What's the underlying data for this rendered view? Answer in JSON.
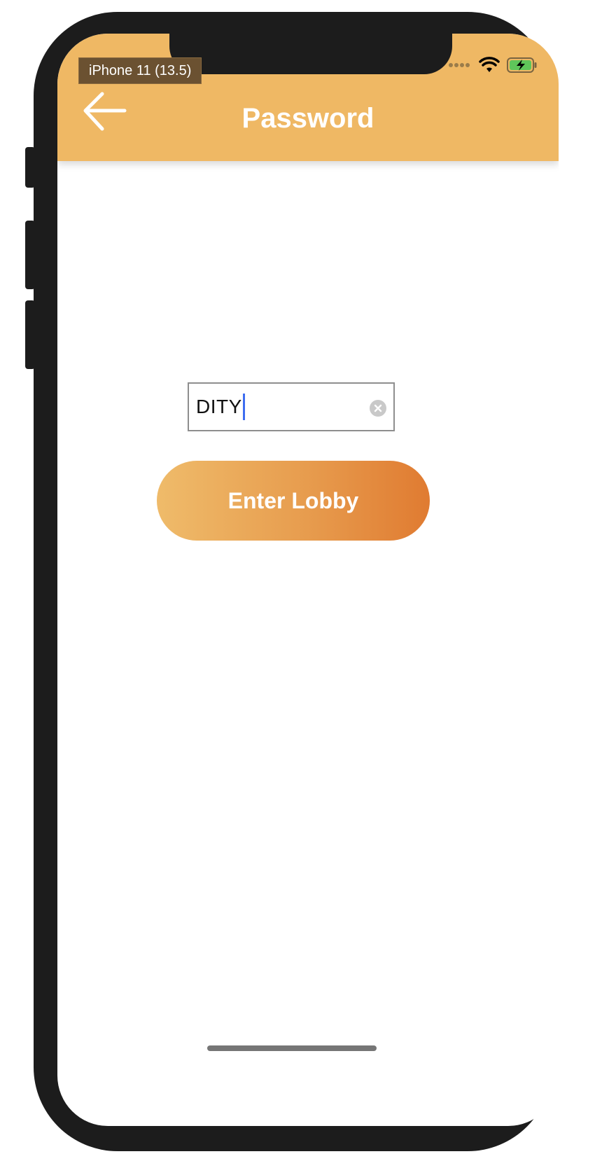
{
  "simulator": {
    "device_label": "iPhone 11 (13.5)"
  },
  "header": {
    "title": "Password",
    "background_color": "#efb864",
    "back_icon": "arrow-left-icon"
  },
  "status_bar": {
    "signal_icon": "signal-dots-icon",
    "wifi_icon": "wifi-icon",
    "battery_icon": "battery-charging-icon"
  },
  "form": {
    "password_value": "DITY",
    "clear_icon": "clear-circle-x-icon",
    "enter_button_label": "Enter Lobby"
  },
  "colors": {
    "accent_start": "#efbb6a",
    "accent_end": "#e07b31",
    "caret": "#3e6df0"
  }
}
